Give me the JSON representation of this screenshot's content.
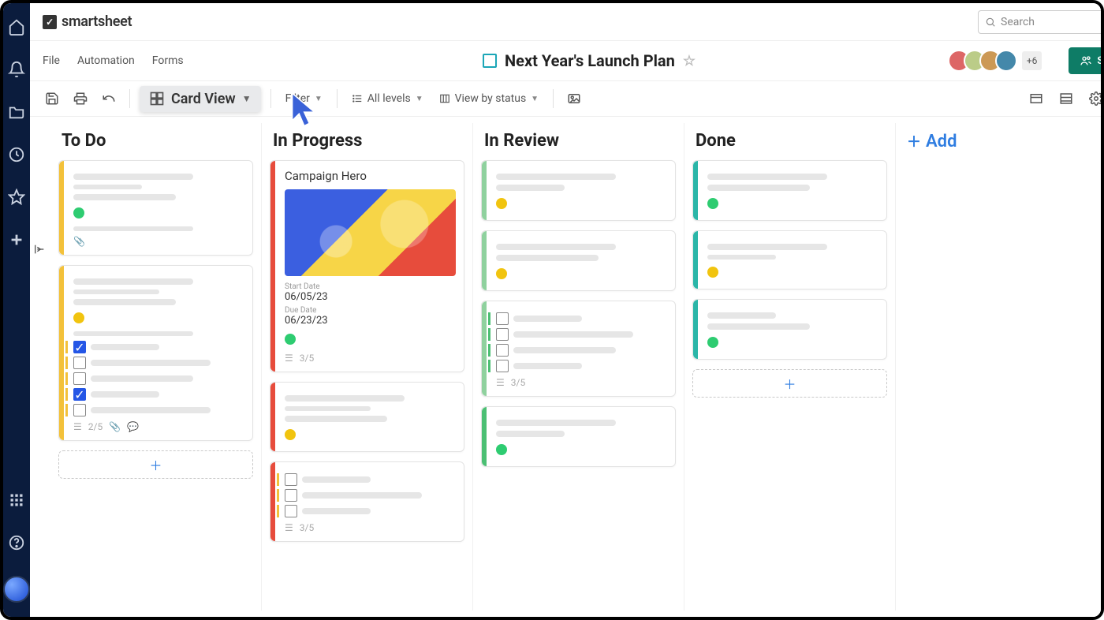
{
  "brand": "smartsheet",
  "search_placeholder": "Search",
  "menu": {
    "file": "File",
    "automation": "Automation",
    "forms": "Forms"
  },
  "doc_title": "Next Year's Launch Plan",
  "avatars_more": "+6",
  "share_label": "Share",
  "toolbar": {
    "view_label": "Card View",
    "filter": "Filter",
    "levels": "All levels",
    "view_by": "View by status"
  },
  "lanes": {
    "todo": "To Do",
    "in_progress": "In Progress",
    "in_review": "In Review",
    "done": "Done",
    "add": "Add"
  },
  "hero_card": {
    "title": "Campaign Hero",
    "start_label": "Start Date",
    "start": "06/05/23",
    "due_label": "Due Date",
    "due": "06/23/23"
  },
  "counts": {
    "three_five": "3/5",
    "two_five": "2/5"
  },
  "colors": {
    "brand_dark": "#0b1c3d",
    "accent_blue": "#2f7de1",
    "share_green": "#0e7c66"
  }
}
